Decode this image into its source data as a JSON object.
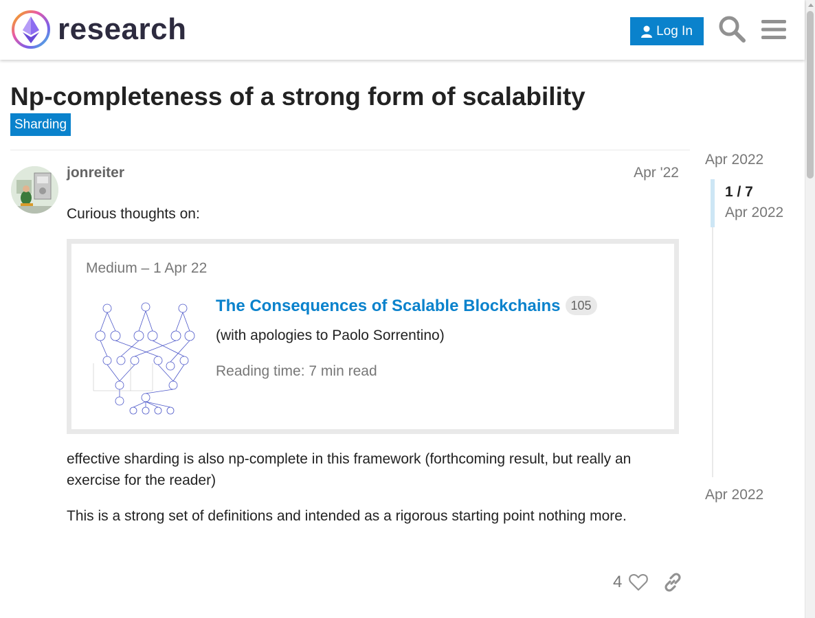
{
  "header": {
    "site_name": "research",
    "login_label": "Log In",
    "accent_color": "#0a82cc"
  },
  "topic": {
    "title": "Np-completeness of a strong form of scalability",
    "category": "Sharding"
  },
  "post": {
    "username": "jonreiter",
    "date": "Apr '22",
    "intro": "Curious thoughts on:",
    "onebox": {
      "source": "Medium – 1 Apr 22",
      "title": "The Consequences of Scalable Blockchains",
      "count": "105",
      "description": "(with apologies to Paolo Sorrentino)",
      "reading_time": "Reading time: 7 min read"
    },
    "paragraph_1": "effective sharding is also np-complete in this framework (forthcoming result, but really an exercise for the reader)",
    "paragraph_2": "This is a strong set of definitions and intended as a rigorous starting point nothing more.",
    "like_count": "4"
  },
  "timeline": {
    "start_date": "Apr 2022",
    "position": "1 / 7",
    "position_date": "Apr 2022",
    "end_date": "Apr 2022"
  },
  "icons": {
    "login": "user-icon",
    "search": "search-icon",
    "menu": "hamburger-icon",
    "like": "heart-icon",
    "share": "link-icon"
  }
}
